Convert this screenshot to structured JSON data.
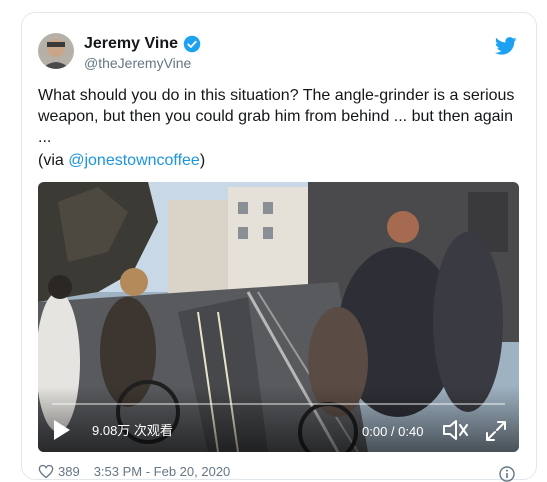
{
  "tweet": {
    "author": {
      "name": "Jeremy Vine",
      "handle": "@theJeremyVine",
      "verified_color": "#1da1f2"
    },
    "text_lines": [
      "What should you do in this situation? The angle-grinder is a serious",
      "weapon, but then you could grab him from behind ... but then again",
      "..."
    ],
    "via_prefix": "(via ",
    "via_link": "@jonestowncoffee",
    "via_suffix": ")",
    "video": {
      "views": "9.08万 次观看",
      "time": "0:00 / 0:40",
      "progress": 0
    },
    "likes": "389",
    "timestamp": "3:53 PM - Feb 20, 2020",
    "icons": {
      "brand": "twitter-bird-icon",
      "verified": "verified-badge-icon",
      "play": "play-icon",
      "volume": "volume-icon",
      "fullscreen": "fullscreen-icon",
      "like": "heart-icon",
      "info": "info-icon"
    },
    "colors": {
      "link": "#1b95e0",
      "secondary": "#657786",
      "brand": "#1da1f2"
    }
  }
}
